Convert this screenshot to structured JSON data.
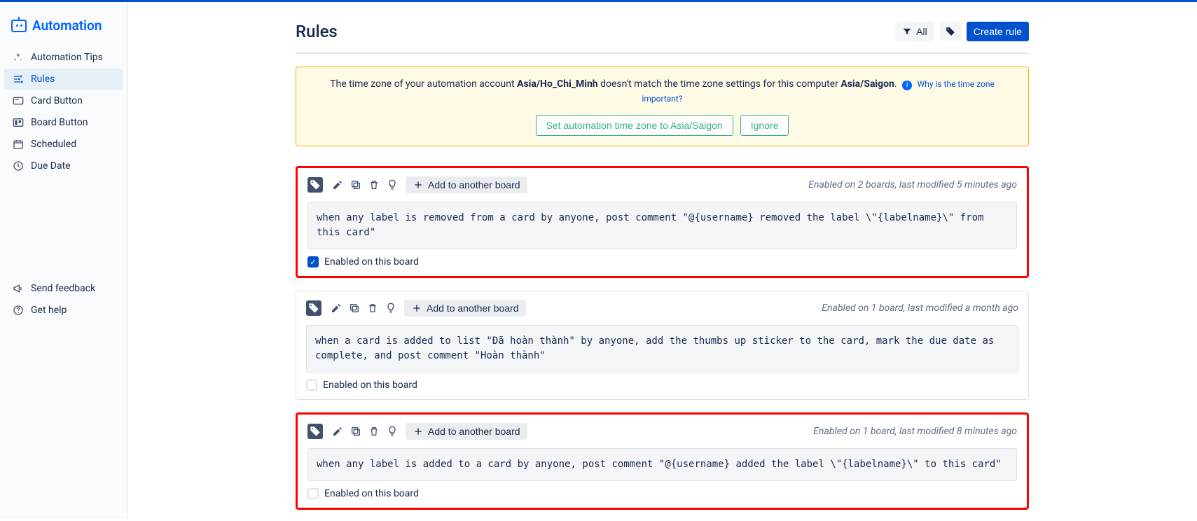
{
  "brand": "Automation",
  "sidebar": {
    "items": [
      {
        "label": "Automation Tips",
        "icon": "sparkle"
      },
      {
        "label": "Rules",
        "icon": "sliders",
        "active": true
      },
      {
        "label": "Card Button",
        "icon": "card"
      },
      {
        "label": "Board Button",
        "icon": "board"
      },
      {
        "label": "Scheduled",
        "icon": "calendar"
      },
      {
        "label": "Due Date",
        "icon": "clock"
      }
    ],
    "footer": [
      {
        "label": "Send feedback",
        "icon": "megaphone"
      },
      {
        "label": "Get help",
        "icon": "help"
      }
    ]
  },
  "page": {
    "title": "Rules",
    "filter_all_label": "All",
    "create_rule_label": "Create rule"
  },
  "timezone_banner": {
    "text_prefix": "The time zone of your automation account ",
    "account_tz": "Asia/Ho_Chi_Minh",
    "text_mid": " doesn't match the time zone settings for this computer ",
    "computer_tz": "Asia/Saigon",
    "text_suffix": ".",
    "link_text": "Why is the time zone important?",
    "set_button": "Set automation time zone to Asia/Saigon",
    "ignore_button": "Ignore"
  },
  "common": {
    "add_to_board": "Add to another board",
    "enabled_label": "Enabled on this board"
  },
  "rules": [
    {
      "meta": "Enabled on 2 boards, last modified 5 minutes ago",
      "body": "when any label is removed from a card by anyone, post comment \"@{username} removed the label \\\"{labelname}\\\" from this card\"",
      "enabled": true,
      "highlighted": true
    },
    {
      "meta": "Enabled on 1 board, last modified a month ago",
      "body": "when a card is added to list \"Đã hoàn thành\" by anyone, add the thumbs up sticker to the card, mark the due date as complete, and post comment \"Hoàn thành\"",
      "enabled": false,
      "highlighted": false
    },
    {
      "meta": "Enabled on 1 board, last modified 8 minutes ago",
      "body": "when any label is added to a card by anyone, post comment \"@{username} added the label \\\"{labelname}\\\" to this card\"",
      "enabled": false,
      "highlighted": true
    }
  ]
}
